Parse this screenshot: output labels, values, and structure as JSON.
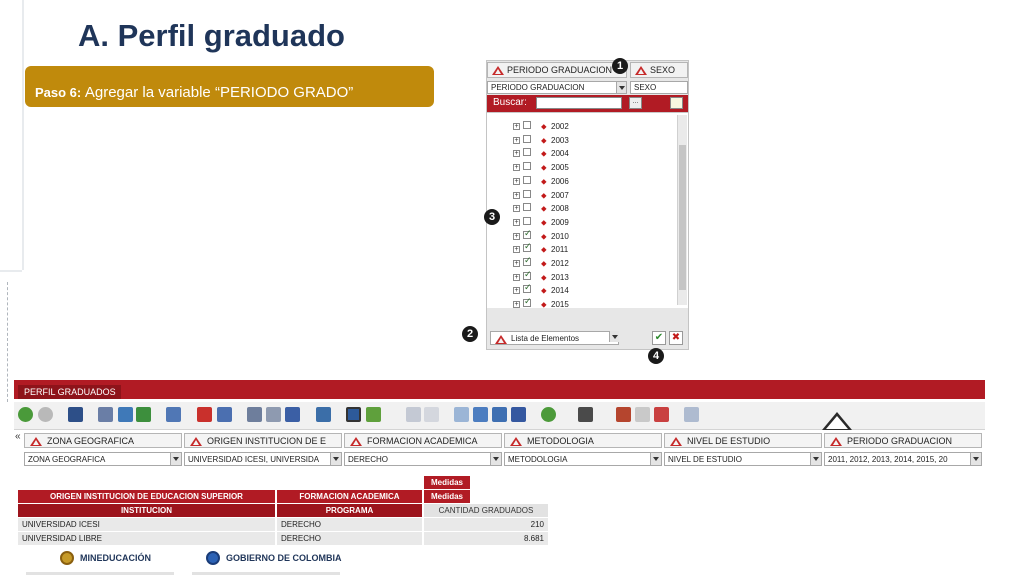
{
  "slide": {
    "title": "A. Perfil graduado",
    "step_label": "Paso 6:",
    "step_text": "Agregar la variable “PERIODO GRADO”"
  },
  "markers": [
    "1",
    "2",
    "3",
    "4"
  ],
  "panel": {
    "tab_active": "PERIODO GRADUACION",
    "tab_other": "SEXO",
    "select_active": "PERIODO GRADUACION",
    "select_other": "SEXO",
    "search_label": "Buscar:",
    "search_value": "",
    "search_btn": "...",
    "items": [
      {
        "label": "2002",
        "checked": false
      },
      {
        "label": "2003",
        "checked": false
      },
      {
        "label": "2004",
        "checked": false
      },
      {
        "label": "2005",
        "checked": false
      },
      {
        "label": "2006",
        "checked": false
      },
      {
        "label": "2007",
        "checked": false
      },
      {
        "label": "2008",
        "checked": false
      },
      {
        "label": "2009",
        "checked": false
      },
      {
        "label": "2010",
        "checked": true
      },
      {
        "label": "2011",
        "checked": true
      },
      {
        "label": "2012",
        "checked": true
      },
      {
        "label": "2013",
        "checked": true
      },
      {
        "label": "2014",
        "checked": true
      },
      {
        "label": "2015",
        "checked": true
      }
    ],
    "list_mode": "Lista de Elementos",
    "ok_symbol": "✔",
    "cancel_symbol": "✖"
  },
  "app": {
    "tab": "PERFIL GRADUADOS",
    "collapse": "«",
    "dimensions": [
      {
        "tab": "ZONA GEOGRAFICA",
        "value": "ZONA GEOGRAFICA"
      },
      {
        "tab": "ORIGEN INSTITUCION DE E",
        "value": "UNIVERSIDAD ICESI, UNIVERSIDA"
      },
      {
        "tab": "FORMACION ACADEMICA",
        "value": "DERECHO"
      },
      {
        "tab": "METODOLOGIA",
        "value": "METODOLOGIA"
      },
      {
        "tab": "NIVEL DE ESTUDIO",
        "value": "NIVEL DE ESTUDIO"
      },
      {
        "tab": "PERIODO GRADUACION",
        "value": "2011, 2012, 2013, 2014, 2015, 20"
      }
    ],
    "grid": {
      "medidas_1": "Medidas",
      "medidas_2": "Medidas",
      "col1_header": "ORIGEN INSTITUCION DE EDUCACION SUPERIOR",
      "col2_header": "FORMACION ACADEMICA",
      "col1_sub": "INSTITUCION",
      "col2_sub": "PROGRAMA",
      "col3_sub": "CANTIDAD GRADUADOS",
      "rows": [
        {
          "inst": "UNIVERSIDAD ICESI",
          "prog": "DERECHO",
          "count": "210"
        },
        {
          "inst": "UNIVERSIDAD LIBRE",
          "prog": "DERECHO",
          "count": "8.681"
        }
      ]
    }
  },
  "footer": {
    "left": "MINEDUCACIÓN",
    "right": "GOBIERNO DE COLOMBIA"
  }
}
